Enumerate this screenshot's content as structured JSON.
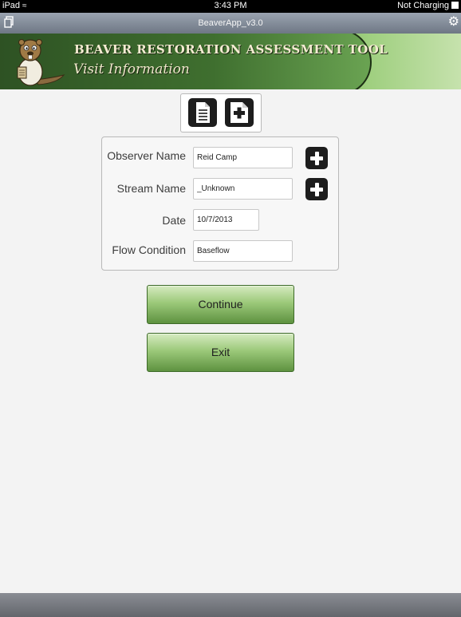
{
  "status_bar": {
    "device": "iPad",
    "time": "3:43 PM",
    "battery": "Not Charging"
  },
  "titlebar": {
    "title": "BeaverApp_v3.0",
    "icons": [
      "copy-icon",
      "gear-icon"
    ]
  },
  "banner": {
    "title": "BEAVER RESTORATION ASSESSMENT TOOL",
    "subtitle": "Visit Information",
    "logo": "beaver-mascot"
  },
  "toolbar": {
    "icons": [
      "document-icon",
      "new-document-icon"
    ]
  },
  "form": {
    "observer_label": "Observer Name",
    "observer_value": "Reid Camp",
    "stream_label": "Stream Name",
    "stream_value": "_Unknown",
    "date_label": "Date",
    "date_value": "10/7/2013",
    "flow_label": "Flow Condition",
    "flow_value": "Baseflow"
  },
  "buttons": {
    "continue": "Continue",
    "exit": "Exit"
  },
  "colors": {
    "banner_dark": "#2f5324",
    "banner_light": "#c6e2ad",
    "button_green": "#9cc97a",
    "plus_button": "#1d1d1d"
  }
}
